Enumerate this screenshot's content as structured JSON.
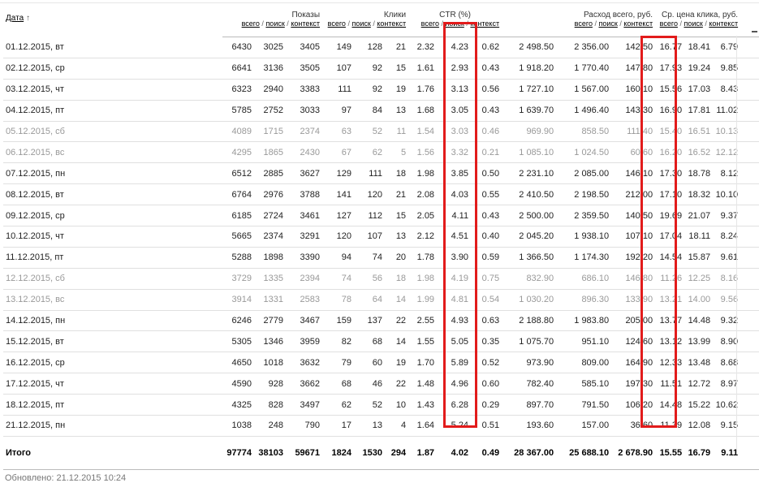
{
  "header": {
    "date_label": "Дата",
    "sort_arrow": "↑",
    "groups": [
      {
        "label": "Показы",
        "colspan": 3
      },
      {
        "label": "Клики",
        "colspan": 3
      },
      {
        "label": "CTR (%)",
        "colspan": 3
      },
      {
        "label": "Расход всего, руб.",
        "colspan": 3
      },
      {
        "label": "Ср. цена клика, руб.",
        "colspan": 3
      }
    ],
    "sub_total": "всего",
    "sub_search": "поиск",
    "sub_context": "контекст",
    "separator": "/"
  },
  "rows": [
    {
      "date": "01.12.2015, вт",
      "weekend": false,
      "impr": [
        "6430",
        "3025",
        "3405"
      ],
      "clicks": [
        "149",
        "128",
        "21"
      ],
      "ctr": [
        "2.32",
        "4.23",
        "0.62"
      ],
      "cost": [
        "2 498.50",
        "2 356.00",
        "142.50"
      ],
      "cpc": [
        "16.77",
        "18.41",
        "6.79"
      ]
    },
    {
      "date": "02.12.2015, ср",
      "weekend": false,
      "impr": [
        "6641",
        "3136",
        "3505"
      ],
      "clicks": [
        "107",
        "92",
        "15"
      ],
      "ctr": [
        "1.61",
        "2.93",
        "0.43"
      ],
      "cost": [
        "1 918.20",
        "1 770.40",
        "147.80"
      ],
      "cpc": [
        "17.93",
        "19.24",
        "9.85"
      ]
    },
    {
      "date": "03.12.2015, чт",
      "weekend": false,
      "impr": [
        "6323",
        "2940",
        "3383"
      ],
      "clicks": [
        "111",
        "92",
        "19"
      ],
      "ctr": [
        "1.76",
        "3.13",
        "0.56"
      ],
      "cost": [
        "1 727.10",
        "1 567.00",
        "160.10"
      ],
      "cpc": [
        "15.56",
        "17.03",
        "8.43"
      ]
    },
    {
      "date": "04.12.2015, пт",
      "weekend": false,
      "impr": [
        "5785",
        "2752",
        "3033"
      ],
      "clicks": [
        "97",
        "84",
        "13"
      ],
      "ctr": [
        "1.68",
        "3.05",
        "0.43"
      ],
      "cost": [
        "1 639.70",
        "1 496.40",
        "143.30"
      ],
      "cpc": [
        "16.90",
        "17.81",
        "11.02"
      ]
    },
    {
      "date": "05.12.2015, сб",
      "weekend": true,
      "impr": [
        "4089",
        "1715",
        "2374"
      ],
      "clicks": [
        "63",
        "52",
        "11"
      ],
      "ctr": [
        "1.54",
        "3.03",
        "0.46"
      ],
      "cost": [
        "969.90",
        "858.50",
        "111.40"
      ],
      "cpc": [
        "15.40",
        "16.51",
        "10.13"
      ]
    },
    {
      "date": "06.12.2015, вс",
      "weekend": true,
      "impr": [
        "4295",
        "1865",
        "2430"
      ],
      "clicks": [
        "67",
        "62",
        "5"
      ],
      "ctr": [
        "1.56",
        "3.32",
        "0.21"
      ],
      "cost": [
        "1 085.10",
        "1 024.50",
        "60.60"
      ],
      "cpc": [
        "16.20",
        "16.52",
        "12.12"
      ]
    },
    {
      "date": "07.12.2015, пн",
      "weekend": false,
      "impr": [
        "6512",
        "2885",
        "3627"
      ],
      "clicks": [
        "129",
        "111",
        "18"
      ],
      "ctr": [
        "1.98",
        "3.85",
        "0.50"
      ],
      "cost": [
        "2 231.10",
        "2 085.00",
        "146.10"
      ],
      "cpc": [
        "17.30",
        "18.78",
        "8.12"
      ]
    },
    {
      "date": "08.12.2015, вт",
      "weekend": false,
      "impr": [
        "6764",
        "2976",
        "3788"
      ],
      "clicks": [
        "141",
        "120",
        "21"
      ],
      "ctr": [
        "2.08",
        "4.03",
        "0.55"
      ],
      "cost": [
        "2 410.50",
        "2 198.50",
        "212.00"
      ],
      "cpc": [
        "17.10",
        "18.32",
        "10.10"
      ]
    },
    {
      "date": "09.12.2015, ср",
      "weekend": false,
      "impr": [
        "6185",
        "2724",
        "3461"
      ],
      "clicks": [
        "127",
        "112",
        "15"
      ],
      "ctr": [
        "2.05",
        "4.11",
        "0.43"
      ],
      "cost": [
        "2 500.00",
        "2 359.50",
        "140.50"
      ],
      "cpc": [
        "19.69",
        "21.07",
        "9.37"
      ]
    },
    {
      "date": "10.12.2015, чт",
      "weekend": false,
      "impr": [
        "5665",
        "2374",
        "3291"
      ],
      "clicks": [
        "120",
        "107",
        "13"
      ],
      "ctr": [
        "2.12",
        "4.51",
        "0.40"
      ],
      "cost": [
        "2 045.20",
        "1 938.10",
        "107.10"
      ],
      "cpc": [
        "17.04",
        "18.11",
        "8.24"
      ]
    },
    {
      "date": "11.12.2015, пт",
      "weekend": false,
      "impr": [
        "5288",
        "1898",
        "3390"
      ],
      "clicks": [
        "94",
        "74",
        "20"
      ],
      "ctr": [
        "1.78",
        "3.90",
        "0.59"
      ],
      "cost": [
        "1 366.50",
        "1 174.30",
        "192.20"
      ],
      "cpc": [
        "14.54",
        "15.87",
        "9.61"
      ]
    },
    {
      "date": "12.12.2015, сб",
      "weekend": true,
      "impr": [
        "3729",
        "1335",
        "2394"
      ],
      "clicks": [
        "74",
        "56",
        "18"
      ],
      "ctr": [
        "1.98",
        "4.19",
        "0.75"
      ],
      "cost": [
        "832.90",
        "686.10",
        "146.80"
      ],
      "cpc": [
        "11.26",
        "12.25",
        "8.16"
      ]
    },
    {
      "date": "13.12.2015, вс",
      "weekend": true,
      "impr": [
        "3914",
        "1331",
        "2583"
      ],
      "clicks": [
        "78",
        "64",
        "14"
      ],
      "ctr": [
        "1.99",
        "4.81",
        "0.54"
      ],
      "cost": [
        "1 030.20",
        "896.30",
        "133.90"
      ],
      "cpc": [
        "13.21",
        "14.00",
        "9.56"
      ]
    },
    {
      "date": "14.12.2015, пн",
      "weekend": false,
      "impr": [
        "6246",
        "2779",
        "3467"
      ],
      "clicks": [
        "159",
        "137",
        "22"
      ],
      "ctr": [
        "2.55",
        "4.93",
        "0.63"
      ],
      "cost": [
        "2 188.80",
        "1 983.80",
        "205.00"
      ],
      "cpc": [
        "13.77",
        "14.48",
        "9.32"
      ]
    },
    {
      "date": "15.12.2015, вт",
      "weekend": false,
      "impr": [
        "5305",
        "1346",
        "3959"
      ],
      "clicks": [
        "82",
        "68",
        "14"
      ],
      "ctr": [
        "1.55",
        "5.05",
        "0.35"
      ],
      "cost": [
        "1 075.70",
        "951.10",
        "124.60"
      ],
      "cpc": [
        "13.12",
        "13.99",
        "8.90"
      ]
    },
    {
      "date": "16.12.2015, ср",
      "weekend": false,
      "impr": [
        "4650",
        "1018",
        "3632"
      ],
      "clicks": [
        "79",
        "60",
        "19"
      ],
      "ctr": [
        "1.70",
        "5.89",
        "0.52"
      ],
      "cost": [
        "973.90",
        "809.00",
        "164.90"
      ],
      "cpc": [
        "12.33",
        "13.48",
        "8.68"
      ]
    },
    {
      "date": "17.12.2015, чт",
      "weekend": false,
      "impr": [
        "4590",
        "928",
        "3662"
      ],
      "clicks": [
        "68",
        "46",
        "22"
      ],
      "ctr": [
        "1.48",
        "4.96",
        "0.60"
      ],
      "cost": [
        "782.40",
        "585.10",
        "197.30"
      ],
      "cpc": [
        "11.51",
        "12.72",
        "8.97"
      ]
    },
    {
      "date": "18.12.2015, пт",
      "weekend": false,
      "impr": [
        "4325",
        "828",
        "3497"
      ],
      "clicks": [
        "62",
        "52",
        "10"
      ],
      "ctr": [
        "1.43",
        "6.28",
        "0.29"
      ],
      "cost": [
        "897.70",
        "791.50",
        "106.20"
      ],
      "cpc": [
        "14.48",
        "15.22",
        "10.62"
      ]
    },
    {
      "date": "21.12.2015, пн",
      "weekend": false,
      "impr": [
        "1038",
        "248",
        "790"
      ],
      "clicks": [
        "17",
        "13",
        "4"
      ],
      "ctr": [
        "1.64",
        "5.24",
        "0.51"
      ],
      "cost": [
        "193.60",
        "157.00",
        "36.60"
      ],
      "cpc": [
        "11.39",
        "12.08",
        "9.15"
      ]
    }
  ],
  "total": {
    "label": "Итого",
    "impr": [
      "97774",
      "38103",
      "59671"
    ],
    "clicks": [
      "1824",
      "1530",
      "294"
    ],
    "ctr": [
      "1.87",
      "4.02",
      "0.49"
    ],
    "cost": [
      "28 367.00",
      "25 688.10",
      "2 678.90"
    ],
    "cpc": [
      "15.55",
      "16.79",
      "9.11"
    ]
  },
  "footer": {
    "updated": "Обновлено: 21.12.2015 10:24"
  },
  "colors": {
    "highlight": "#e21b1b",
    "weekend_text": "#999999"
  }
}
